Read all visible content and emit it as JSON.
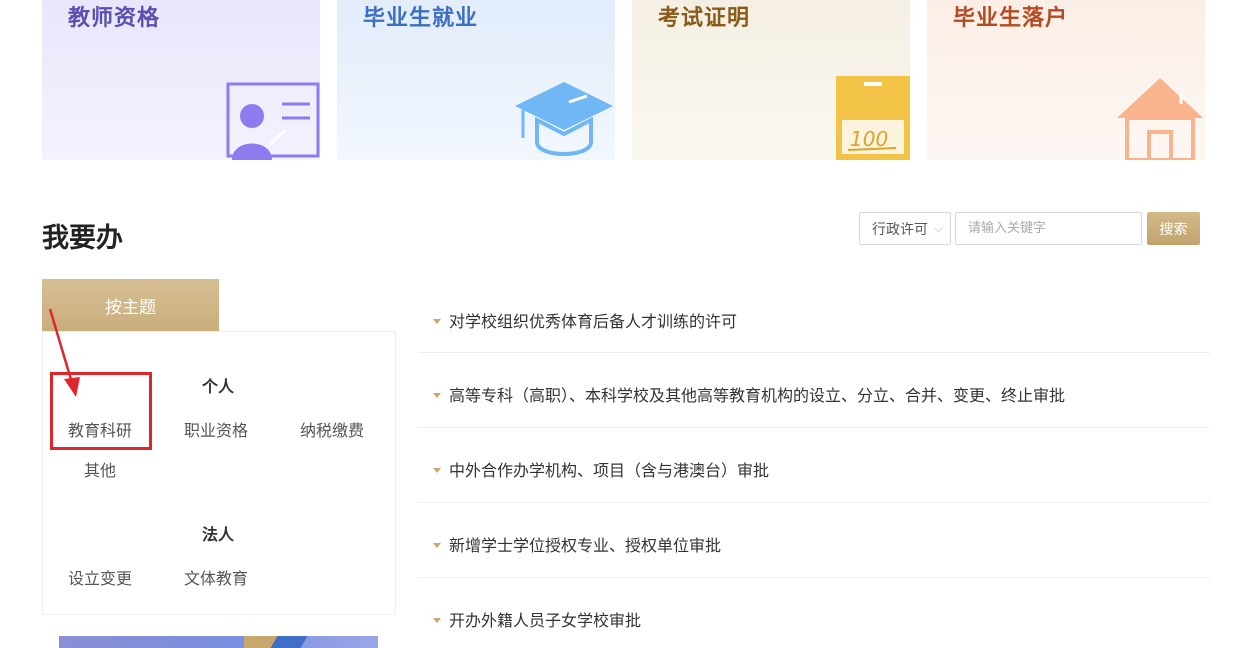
{
  "cards": [
    {
      "title": "教师资格",
      "icon": "teacher-certificate-icon"
    },
    {
      "title": "毕业生就业",
      "icon": "graduation-cap-icon"
    },
    {
      "title": "考试证明",
      "icon": "score-100-icon"
    },
    {
      "title": "毕业生落户",
      "icon": "house-icon"
    }
  ],
  "section": {
    "title": "我要办"
  },
  "search": {
    "filter_selected": "行政许可",
    "placeholder": "请输入关键字",
    "button_label": "搜索"
  },
  "theme_tab": {
    "label": "按主题"
  },
  "groups": [
    {
      "heading": "个人",
      "topics": [
        "教育科研",
        "职业资格",
        "纳税缴费",
        "其他"
      ]
    },
    {
      "heading": "法人",
      "topics": [
        "设立变更",
        "文体教育"
      ]
    }
  ],
  "items": [
    "对学校组织优秀体育后备人才训练的许可",
    "高等专科（高职）、本科学校及其他高等教育机构的设立、分立、合并、变更、终止审批",
    "中外合作办学机构、项目（含与港澳台）审批",
    "新增学士学位授权专业、授权单位审批",
    "开办外籍人员子女学校审批"
  ],
  "colors": {
    "accent_gold": "#c9a76c",
    "highlight_red": "#e0262a",
    "teacher_purple": "#8d7cf0",
    "grad_blue": "#6fb8f5",
    "exam_yellow": "#f2c347",
    "settle_orange": "#f9b48e"
  }
}
